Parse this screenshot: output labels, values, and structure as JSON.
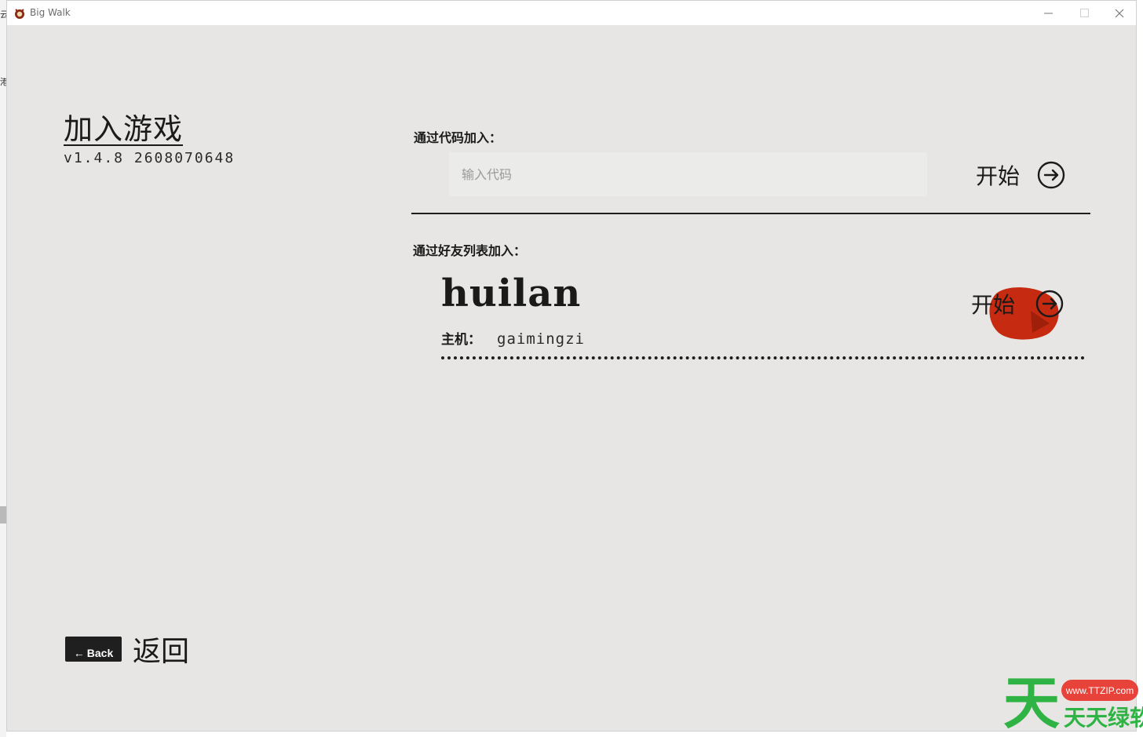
{
  "window": {
    "title": "Big Walk"
  },
  "page": {
    "title": "加入游戏",
    "version": "v1.4.8 2608070648"
  },
  "join_by_code": {
    "label": "通过代码加入：",
    "input_placeholder": "输入代码",
    "input_value": "",
    "start_label": "开始"
  },
  "join_by_friends": {
    "label": "通过好友列表加入：",
    "friends": [
      {
        "name": "huilan",
        "host_label": "主机：",
        "host_value": "gaimingzi",
        "start_label": "开始"
      }
    ]
  },
  "back": {
    "key_label": "Back",
    "label": "返回"
  },
  "watermark": {
    "big_char": "天",
    "site": "www.TTZIP.com",
    "name": "天天绿软"
  },
  "colors": {
    "background": "#e7e6e4",
    "ink": "#1a1a1a",
    "highlight_blob": "#c62a10",
    "watermark_green": "#2fb344",
    "watermark_red": "#e8433a"
  }
}
